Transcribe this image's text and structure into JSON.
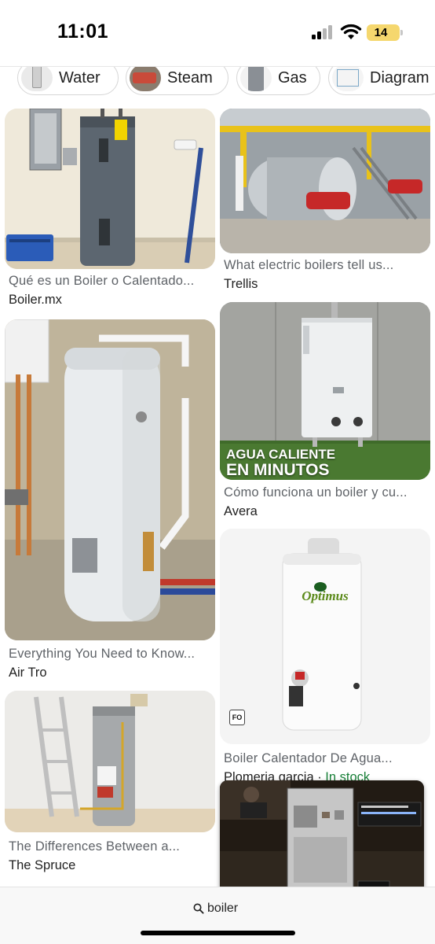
{
  "status_bar": {
    "time": "11:01",
    "battery": "14"
  },
  "chips": [
    {
      "label": "Water"
    },
    {
      "label": "Steam"
    },
    {
      "label": "Gas"
    },
    {
      "label": "Diagram"
    }
  ],
  "results": [
    {
      "title": "Qué es un Boiler o Calentado...",
      "source": "Boiler.mx"
    },
    {
      "title": "What electric boilers tell us...",
      "source": "Trellis"
    },
    {
      "title": "Everything You Need to Know...",
      "source": "Air Tro"
    },
    {
      "title": "Cómo funciona un boiler y cu...",
      "source": "Avera",
      "overlay_line1": "AGUA CALIENTE",
      "overlay_line2": "EN MINUTOS"
    },
    {
      "title": "Boiler Calentador De Agua...",
      "source": "Plomeria garcia · ",
      "stock": "In stock",
      "brand": "Optimus",
      "badge": "FO"
    },
    {
      "title": "The Differences Between a...",
      "source": "The Spruce"
    }
  ],
  "search": {
    "query": "boiler"
  },
  "colors": {
    "in_stock": "#188038",
    "battery": "#f5d76e",
    "muted_text": "#5f6368"
  }
}
